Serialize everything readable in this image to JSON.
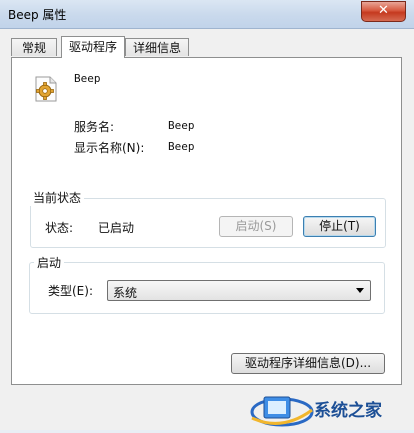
{
  "window": {
    "title": "Beep 属性",
    "close_symbol": "✕"
  },
  "tabs": [
    {
      "label": "常规",
      "active": false
    },
    {
      "label": "驱动程序",
      "active": true
    },
    {
      "label": "详细信息",
      "active": false
    }
  ],
  "service": {
    "icon": "gear-icon",
    "name": "Beep",
    "service_name_label": "服务名:",
    "service_name_value": "Beep",
    "display_name_label": "显示名称(N):",
    "display_name_value": "Beep"
  },
  "current_status": {
    "legend": "当前状态",
    "status_label": "状态:",
    "status_value": "已启动",
    "start_button": "启动(S)",
    "stop_button": "停止(T)"
  },
  "startup": {
    "legend": "启动",
    "type_label": "类型(E):",
    "type_value": "系统"
  },
  "driver_details_button": "驱动程序详细信息(D)...",
  "watermark": {
    "text": "系统之家"
  }
}
